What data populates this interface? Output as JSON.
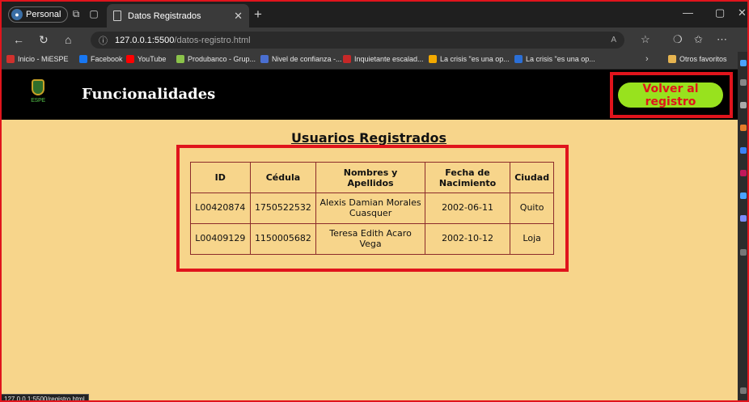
{
  "browser": {
    "profile_label": "Personal",
    "tab_title": "Datos Registrados",
    "url_host": "127.0.0.1:5500",
    "url_path": "/datos-registro.html",
    "status_url": "127.0.0.1:5500/registro.html"
  },
  "favorites": [
    {
      "label": "Inicio - MiESPE",
      "color": "#d0312d"
    },
    {
      "label": "Facebook",
      "color": "#1877f2"
    },
    {
      "label": "YouTube",
      "color": "#ff0000"
    },
    {
      "label": "Produbanco - Grup...",
      "color": "#8bc34a"
    },
    {
      "label": "Nivel de confianza -...",
      "color": "#4a6fd1"
    },
    {
      "label": "Inquietante escalad...",
      "color": "#c62828"
    },
    {
      "label": "La crisis \"es una op...",
      "color": "#f2a900"
    },
    {
      "label": "La crisis \"es una op...",
      "color": "#2b6fd6"
    }
  ],
  "favorites_folder": "Otros favoritos",
  "header": {
    "title": "Funcionalidades",
    "logo_text": "ESPE",
    "back_button": "Volver al registro"
  },
  "main": {
    "heading": "Usuarios Registrados",
    "columns": [
      "ID",
      "Cédula",
      "Nombres y Apellidos",
      "Fecha de Nacimiento",
      "Ciudad"
    ],
    "rows": [
      [
        "L00420874",
        "1750522532",
        "Alexis Damian Morales Cuasquer",
        "2002-06-11",
        "Quito"
      ],
      [
        "L00409129",
        "1150005682",
        "Teresa Edith Acaro Vega",
        "2002-10-12",
        "Loja"
      ]
    ]
  },
  "colors": {
    "page_bg": "#f7d58b",
    "header_bg": "#000000",
    "button_bg": "#98e21e",
    "button_text": "#e0141c",
    "highlight": "#e0141c"
  }
}
